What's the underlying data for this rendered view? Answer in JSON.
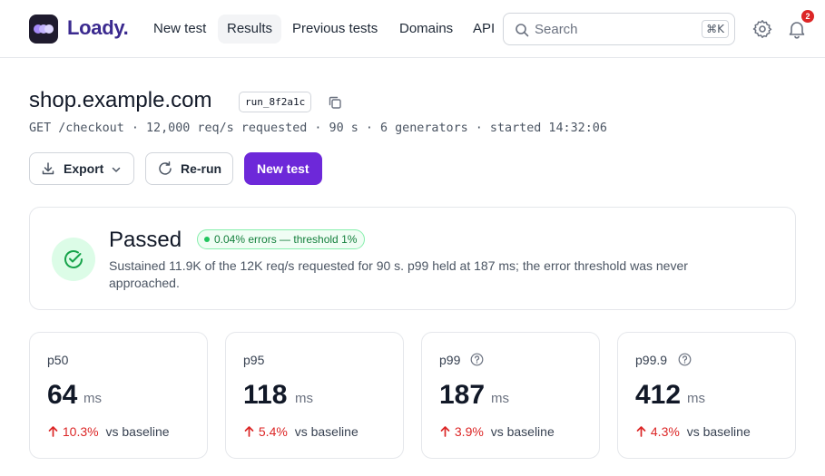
{
  "brand": {
    "name": "Loady.",
    "colors": {
      "accent": "#6d28d9",
      "brand_text": "#3b2a8f",
      "logo_bg": "#1f1b2e",
      "success": "#16a34a",
      "danger": "#dc2626"
    }
  },
  "nav": {
    "items": [
      {
        "label": "New test",
        "active": false
      },
      {
        "label": "Results",
        "active": true
      },
      {
        "label": "Previous tests",
        "active": false
      },
      {
        "label": "Domains",
        "active": false
      },
      {
        "label": "API",
        "active": false
      }
    ]
  },
  "search": {
    "placeholder": "Search",
    "value": "",
    "shortcut": "⌘K",
    "icon": "search-icon"
  },
  "header_icons": {
    "settings_icon": "gear-icon",
    "notifications_icon": "bell-icon",
    "notification_count": "2"
  },
  "run": {
    "title": "shop.example.com",
    "id": "run_8f2a1c",
    "summary": "GET /checkout · 12,000 req/s requested · 90 s · 6 generators · started 14:32:06"
  },
  "actions": {
    "export_label": "Export",
    "rerun_label": "Re-run",
    "new_test_label": "New test"
  },
  "status": {
    "title": "Passed",
    "pill": "0.04% errors — threshold 1%",
    "description": "Sustained 11.9K of the 12K req/s requested for 90 s. p99 held at 187 ms; the error threshold was never approached."
  },
  "metrics": [
    {
      "label": "p50",
      "value": "64",
      "unit": "ms",
      "delta": "10.3%",
      "note": "vs baseline",
      "help": false
    },
    {
      "label": "p95",
      "value": "118",
      "unit": "ms",
      "delta": "5.4%",
      "note": "vs baseline",
      "help": false
    },
    {
      "label": "p99",
      "value": "187",
      "unit": "ms",
      "delta": "3.9%",
      "note": "vs baseline",
      "help": true
    },
    {
      "label": "p99.9",
      "value": "412",
      "unit": "ms",
      "delta": "4.3%",
      "note": "vs baseline",
      "help": true
    }
  ]
}
